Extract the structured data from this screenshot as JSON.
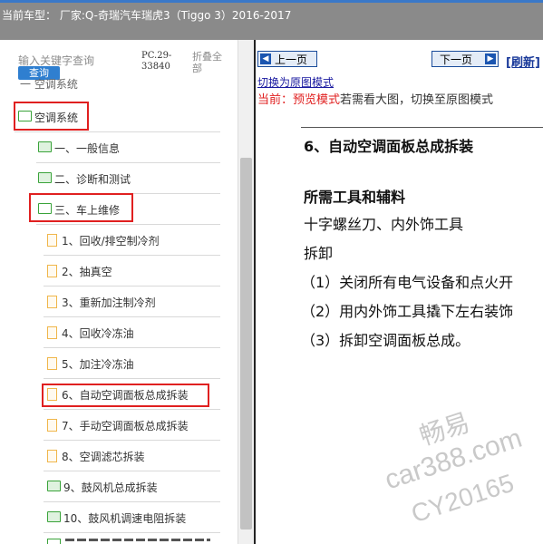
{
  "header": {
    "title": "当前车型：  厂家:Q-奇瑞汽车瑞虎3（Tiggo 3）2016-2017"
  },
  "sidebar": {
    "search_placeholder": "输入关键字查询",
    "search_button": "查询",
    "pc_code": "PC.29-33840",
    "fold_all": "折叠全部",
    "partial_item": "一 空调系统",
    "items": [
      {
        "label": "空调系统",
        "icon": "folder-open-icon",
        "highlighted": true
      },
      {
        "label": "一、一般信息",
        "icon": "folder-closed-icon",
        "highlighted": false
      },
      {
        "label": "二、诊断和测试",
        "icon": "folder-closed-icon",
        "highlighted": false
      },
      {
        "label": "三、车上维修",
        "icon": "folder-open-icon",
        "highlighted": true
      },
      {
        "label": "1、回收/排空制冷剂",
        "icon": "file-icon",
        "highlighted": false
      },
      {
        "label": "2、抽真空",
        "icon": "file-icon",
        "highlighted": false
      },
      {
        "label": "3、重新加注制冷剂",
        "icon": "file-icon",
        "highlighted": false
      },
      {
        "label": "4、回收冷冻油",
        "icon": "file-icon",
        "highlighted": false
      },
      {
        "label": "5、加注冷冻油",
        "icon": "file-icon",
        "highlighted": false
      },
      {
        "label": "6、自动空调面板总成拆装",
        "icon": "file-icon",
        "highlighted": true
      },
      {
        "label": "7、手动空调面板总成拆装",
        "icon": "file-icon",
        "highlighted": false
      },
      {
        "label": "8、空调滤芯拆装",
        "icon": "file-icon",
        "highlighted": false
      },
      {
        "label": "9、鼓风机总成拆装",
        "icon": "folder-closed-icon",
        "highlighted": false
      },
      {
        "label": "10、鼓风机调速电阻拆装",
        "icon": "folder-closed-icon",
        "highlighted": false
      }
    ]
  },
  "viewer": {
    "prev_button": "上一页",
    "next_button": "下一页",
    "refresh_link": "[刷新]",
    "switch_link": "切换为原图模式",
    "preview_mode_label": "当前：预览模式",
    "preview_hint": "若需看大图，切换至原图模式"
  },
  "document": {
    "title": "6、自动空调面板总成拆装",
    "tools_heading": "所需工具和辅料",
    "tools": "十字螺丝刀、内外饰工具",
    "removal_heading": "拆卸",
    "steps": [
      "（1）关闭所有电气设备和点火开",
      "（2）用内外饰工具撬下左右装饰",
      "（3）拆卸空调面板总成。"
    ]
  },
  "watermark": {
    "line1": "畅易",
    "line2": "car388.com",
    "line3": "CY20165"
  },
  "colors": {
    "highlight_border": "#e02020",
    "folder_green": "#3aa33a",
    "file_orange": "#f0b64a",
    "search_button_blue": "#2f7fd0",
    "nav_blue": "#1a4c9a"
  }
}
